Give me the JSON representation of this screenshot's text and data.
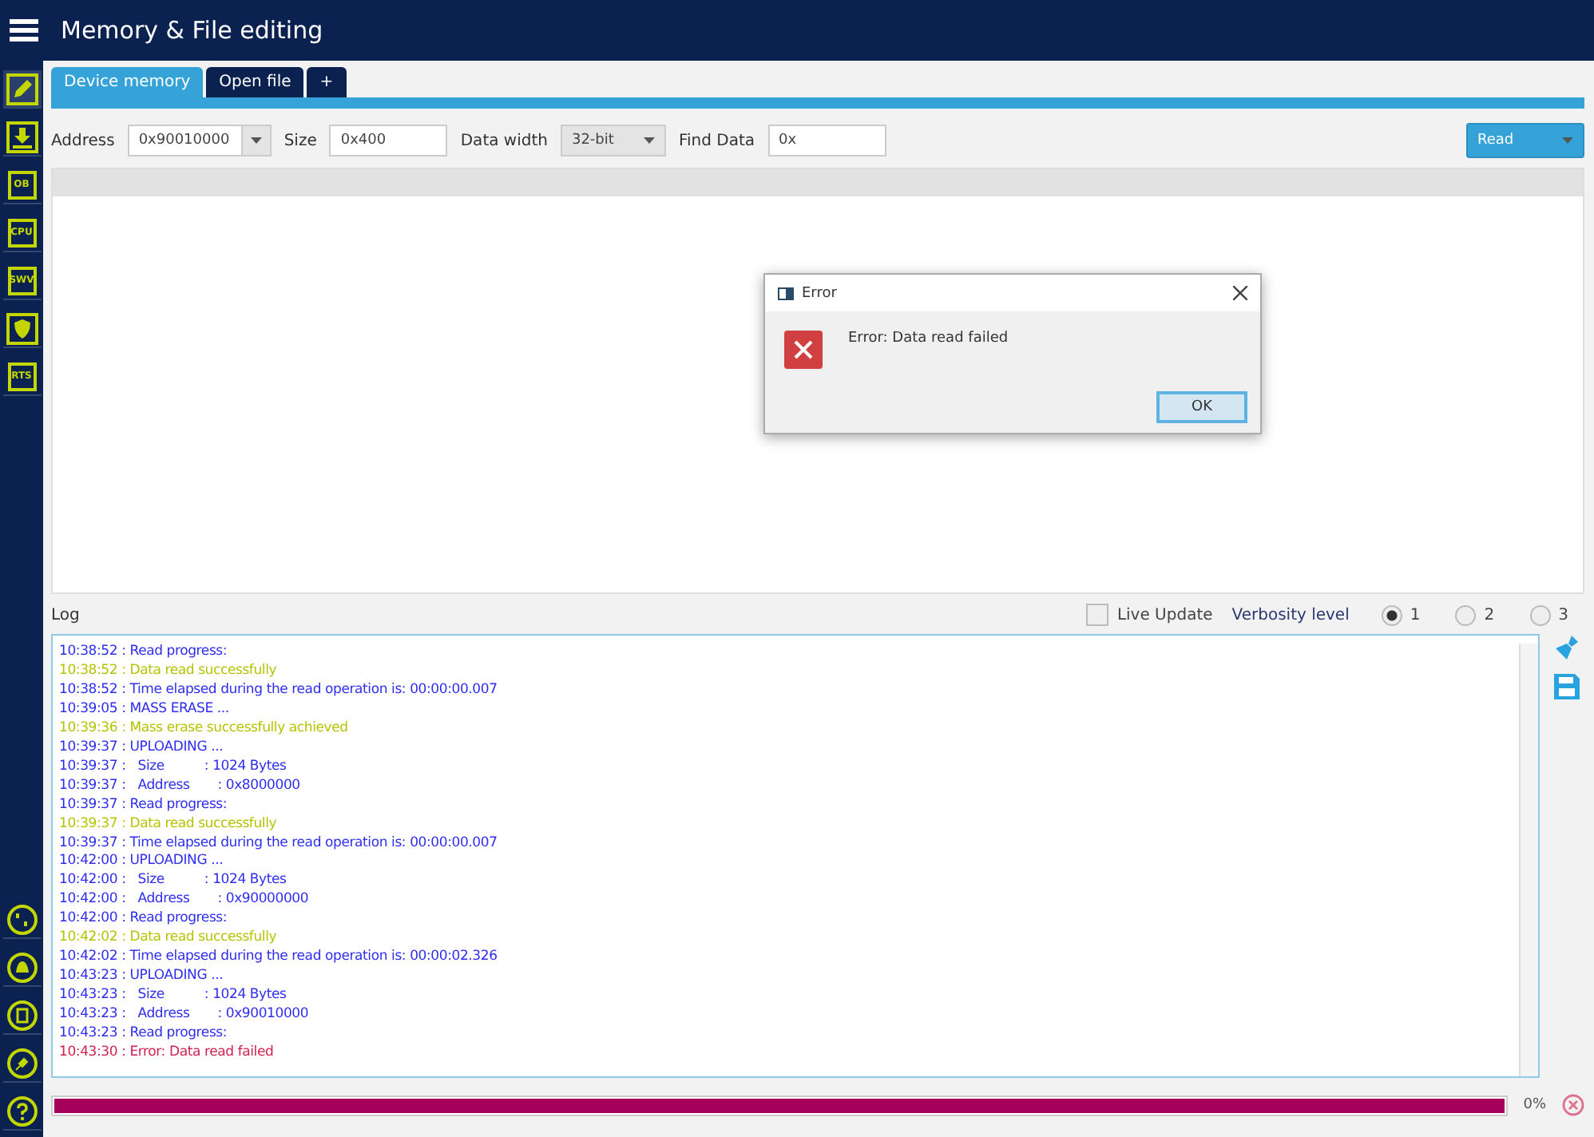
{
  "header": {
    "title": "Memory & File editing"
  },
  "sidebar": {
    "top_items": [
      {
        "kind": "edit",
        "selected": true
      },
      {
        "kind": "download",
        "selected": false
      },
      {
        "kind": "label",
        "label": "OB",
        "selected": false
      },
      {
        "kind": "label",
        "label": "CPU",
        "selected": false
      },
      {
        "kind": "label",
        "label": "SWV",
        "selected": false
      },
      {
        "kind": "shield",
        "selected": false
      },
      {
        "kind": "label",
        "label": "RTS",
        "selected": false
      }
    ],
    "bottom_items": [
      {
        "kind": "binary"
      },
      {
        "kind": "bell"
      },
      {
        "kind": "chip"
      },
      {
        "kind": "plug"
      },
      {
        "kind": "help"
      }
    ]
  },
  "tabs": [
    {
      "label": "Device memory",
      "selected": true
    },
    {
      "label": "Open file",
      "selected": false
    },
    {
      "label": "+",
      "selected": false
    }
  ],
  "toolbar": {
    "address_label": "Address",
    "address": "0x90010000",
    "size_label": "Size",
    "size": "0x400",
    "width_label": "Data width",
    "width": "32-bit",
    "find_label": "Find Data",
    "find": "0x",
    "read_button": "Read"
  },
  "dialog": {
    "title": "Error",
    "message": "Error: Data read failed",
    "ok": "OK"
  },
  "log": {
    "title": "Log",
    "live_update": {
      "label": "Live Update",
      "checked": false
    },
    "verbosity_label": "Verbosity level",
    "verbosity": [
      {
        "label": "1",
        "selected": true
      },
      {
        "label": "2",
        "selected": false
      },
      {
        "label": "3",
        "selected": false
      }
    ],
    "lines": [
      {
        "kind": "info",
        "text": "10:38:52 : Read progress:"
      },
      {
        "kind": "success",
        "text": "10:38:52 : Data read successfully"
      },
      {
        "kind": "info",
        "text": "10:38:52 : Time elapsed during the read operation is: 00:00:00.007"
      },
      {
        "kind": "info",
        "text": "10:39:05 : MASS ERASE ..."
      },
      {
        "kind": "success",
        "text": "10:39:36 : Mass erase successfully achieved"
      },
      {
        "kind": "info",
        "text": "10:39:37 : UPLOADING ..."
      },
      {
        "kind": "info",
        "text": "10:39:37 :   Size          : 1024 Bytes"
      },
      {
        "kind": "info",
        "text": "10:39:37 :   Address       : 0x8000000"
      },
      {
        "kind": "info",
        "text": "10:39:37 : Read progress:"
      },
      {
        "kind": "success",
        "text": "10:39:37 : Data read successfully"
      },
      {
        "kind": "info",
        "text": "10:39:37 : Time elapsed during the read operation is: 00:00:00.007"
      },
      {
        "kind": "info",
        "text": "10:42:00 : UPLOADING ..."
      },
      {
        "kind": "info",
        "text": "10:42:00 :   Size          : 1024 Bytes"
      },
      {
        "kind": "info",
        "text": "10:42:00 :   Address       : 0x90000000"
      },
      {
        "kind": "info",
        "text": "10:42:00 : Read progress:"
      },
      {
        "kind": "success",
        "text": "10:42:02 : Data read successfully"
      },
      {
        "kind": "info",
        "text": "10:42:02 : Time elapsed during the read operation is: 00:00:02.326"
      },
      {
        "kind": "info",
        "text": "10:43:23 : UPLOADING ..."
      },
      {
        "kind": "info",
        "text": "10:43:23 :   Size          : 1024 Bytes"
      },
      {
        "kind": "info",
        "text": "10:43:23 :   Address       : 0x90010000"
      },
      {
        "kind": "info",
        "text": "10:43:23 : Read progress:"
      },
      {
        "kind": "error",
        "text": "10:43:30 : Error: Data read failed"
      }
    ]
  },
  "progress": {
    "level": 1,
    "reading": "0%"
  }
}
